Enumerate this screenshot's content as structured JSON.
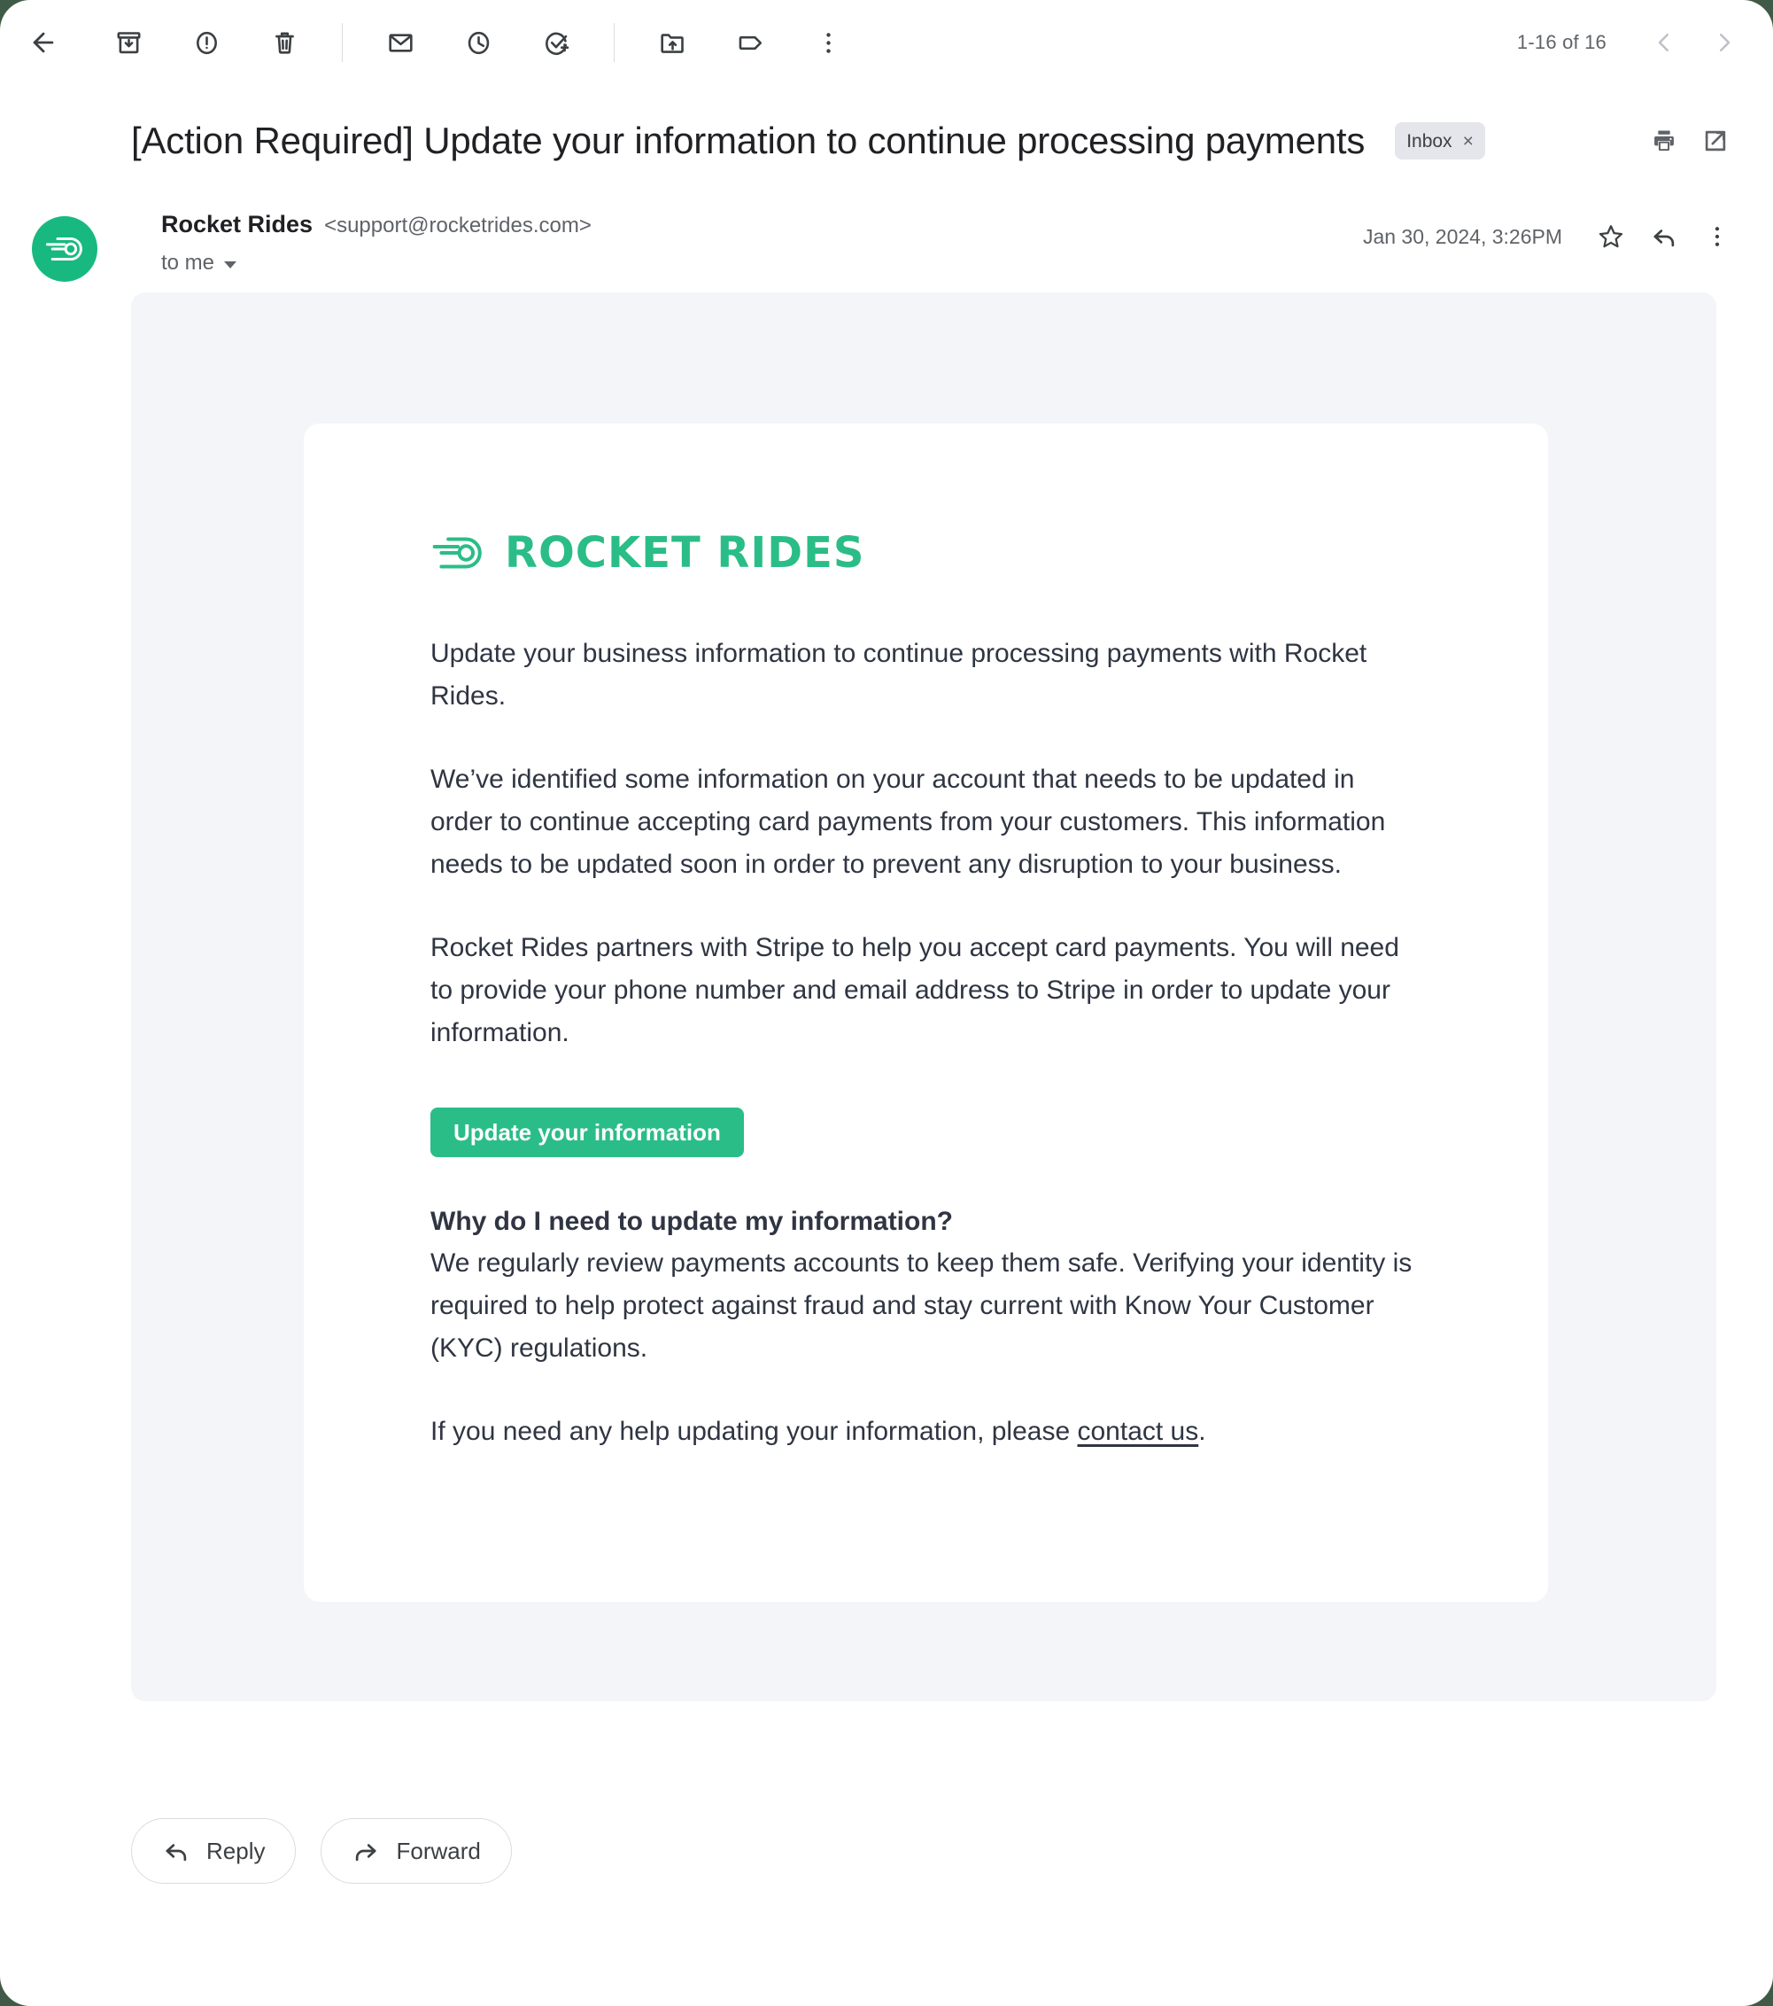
{
  "toolbar": {
    "back_label": "Back",
    "icons": [
      {
        "name": "archive-icon",
        "label": "Archive"
      },
      {
        "name": "report-spam-icon",
        "label": "Report spam"
      },
      {
        "name": "delete-icon",
        "label": "Delete"
      },
      {
        "name": "mark-unread-icon",
        "label": "Mark as unread"
      },
      {
        "name": "snooze-icon",
        "label": "Snooze"
      },
      {
        "name": "add-to-tasks-icon",
        "label": "Add to tasks"
      },
      {
        "name": "move-to-icon",
        "label": "Move to"
      },
      {
        "name": "label-icon",
        "label": "Labels"
      },
      {
        "name": "more-options-icon",
        "label": "More"
      }
    ],
    "pager_count": "1-16 of 16",
    "prev_label": "Newer",
    "next_label": "Older"
  },
  "subject": {
    "prefix": "[Action Required]",
    "text": "Update your information to continue processing payments",
    "full": "[Action Required]  Update your information to continue processing payments",
    "chip_label": "Inbox",
    "chip_close": "×",
    "print_label": "Print all",
    "open_new_label": "Open in new window"
  },
  "message": {
    "sender_name": "Rocket Rides",
    "sender_email": "<support@rocketrides.com>",
    "recipient": "to me",
    "timestamp": "Jan 30, 2024, 3:26PM",
    "star_label": "Star",
    "reply_icon_label": "Reply",
    "more_icon_label": "More"
  },
  "email": {
    "brand_name": "ROCKET RIDES",
    "brand_color": "#2bbd87",
    "paragraph_1": "Update your business information to continue processing payments with Rocket Rides.",
    "paragraph_2": "We’ve identified some information on your account that needs to be updated in order to continue accepting card payments from your customers. This information needs to be updated soon in order to prevent any disruption to your business.",
    "paragraph_3": "Rocket Rides partners with Stripe to help you accept card payments. You will need to provide your phone number and email address to Stripe in order to update your information.",
    "cta_label": "Update your information",
    "faq_heading": "Why do I need to update my information?",
    "faq_body": "We regularly review payments accounts to keep them safe. Verifying your identity is required to help protect against fraud and stay current with Know Your Customer (KYC) regulations.",
    "help_prefix": "If you need any help updating your information, please ",
    "help_link": "contact us",
    "help_suffix": "."
  },
  "bottom": {
    "reply_label": "Reply",
    "forward_label": "Forward"
  }
}
